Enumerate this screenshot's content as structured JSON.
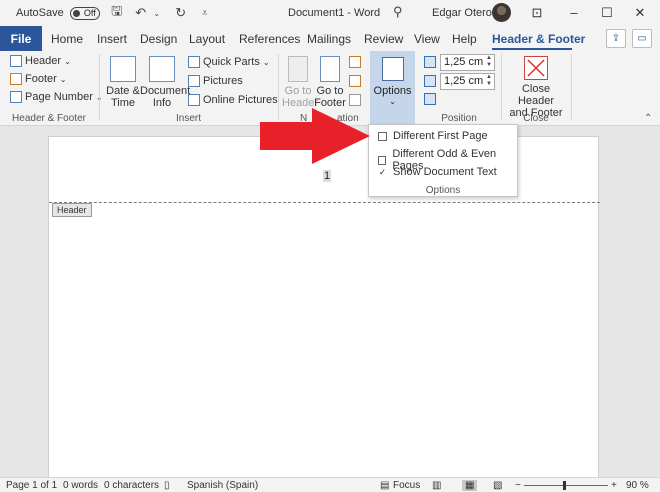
{
  "titlebar": {
    "autosave_label": "AutoSave",
    "autosave_state": "Off",
    "doc_title": "Document1  -  Word",
    "user_name": "Edgar Otero",
    "search_icon": "search-icon",
    "minimize_icon": "minimize-icon",
    "restore_icon": "restore-icon",
    "maximize_icon": "maximize-icon",
    "close_icon": "close-icon",
    "quick_access": [
      "save-icon",
      "undo-icon",
      "redo-icon",
      "customize-icon"
    ]
  },
  "tabs": {
    "file": "File",
    "items": [
      "Home",
      "Insert",
      "Design",
      "Layout",
      "References",
      "Mailings",
      "Review",
      "View",
      "Help"
    ],
    "active": "Header & Footer"
  },
  "ribbon": {
    "header_footer": {
      "header": "Header",
      "footer": "Footer",
      "page_number": "Page Number",
      "label": "Header & Footer"
    },
    "insert": {
      "date_time_line1": "Date &",
      "date_time_line2": "Time",
      "doc_info_line1": "Document",
      "doc_info_line2": "Info",
      "quick_parts": "Quick Parts",
      "pictures": "Pictures",
      "online_pictures": "Online Pictures",
      "label": "Insert"
    },
    "navigation": {
      "goto_header_line1": "Go to",
      "goto_header_line2": "Header",
      "goto_footer_line1": "Go to",
      "goto_footer_line2": "Footer",
      "label_start": "N",
      "label_end": "ation"
    },
    "options": {
      "label": "Options"
    },
    "position": {
      "header_pos": "1,25 cm",
      "footer_pos": "1,25 cm",
      "label": "Position"
    },
    "close": {
      "line1": "Close Header",
      "line2": "and Footer",
      "label": "Close"
    }
  },
  "dropdown": {
    "items": [
      {
        "label": "Different First Page",
        "checked": false
      },
      {
        "label": "Different Odd & Even Pages",
        "checked": false
      },
      {
        "label": "Show Document Text",
        "checked": true
      }
    ],
    "group_label": "Options",
    "check_mark": "✓"
  },
  "document": {
    "page_number": "1",
    "header_tag": "Header"
  },
  "statusbar": {
    "page": "Page 1 of 1",
    "words": "0 words",
    "characters": "0 characters",
    "language": "Spanish (Spain)",
    "focus": "Focus",
    "zoom": "90 %",
    "zoom_minus": "−",
    "zoom_plus": "+"
  },
  "colors": {
    "accent": "#2b579a",
    "options_highlight": "#c5d5ea",
    "arrow": "#e8202a"
  }
}
